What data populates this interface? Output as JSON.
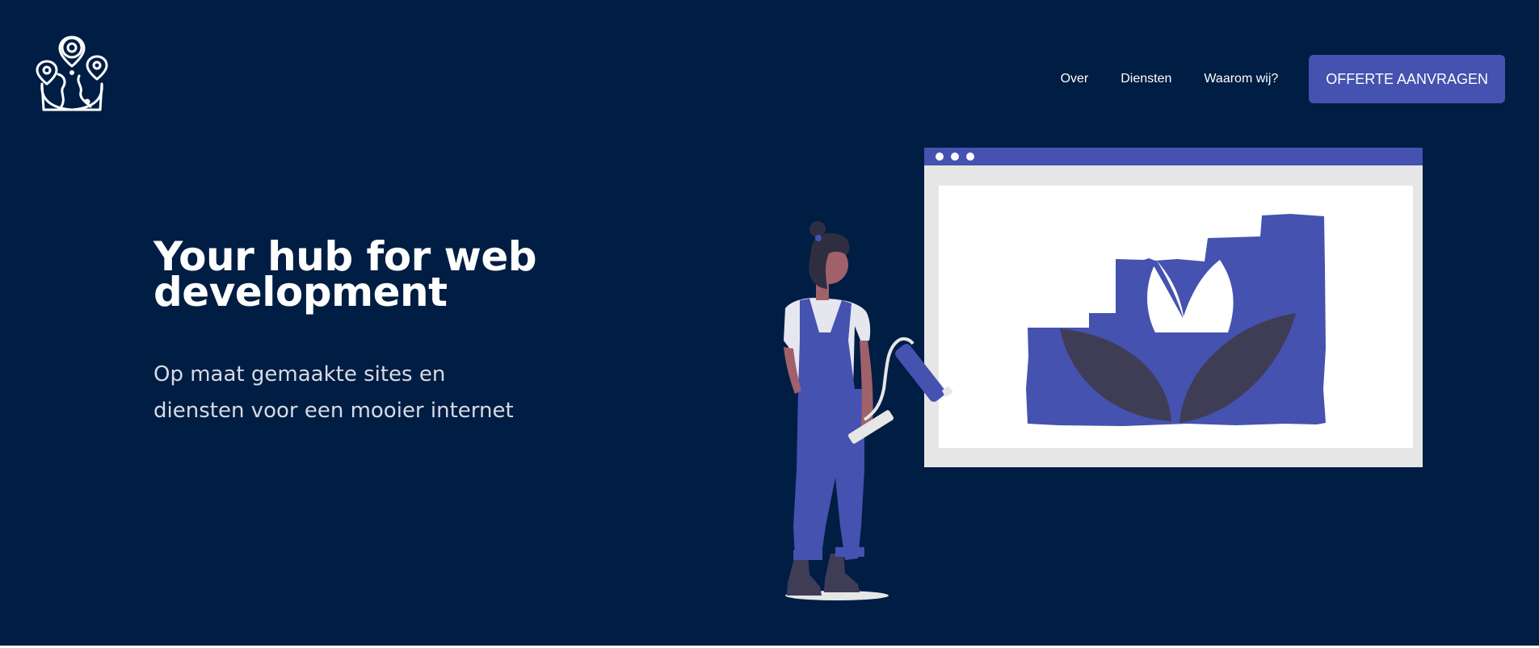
{
  "header": {
    "logo_icon": "globe-with-map-pins-icon",
    "nav": {
      "over": "Over",
      "diensten": "Diensten",
      "waarom": "Waarom wij?",
      "cta": "OFFERTE AANVRAGEN"
    }
  },
  "hero": {
    "title": "Your hub for web development",
    "subtitle": "Op maat gemaakte sites en diensten voor een mooier internet",
    "illustration_icon": "woman-painting-website-illustration"
  },
  "colors": {
    "background": "#001d43",
    "accent": "#4552b0",
    "text": "#ffffff"
  }
}
